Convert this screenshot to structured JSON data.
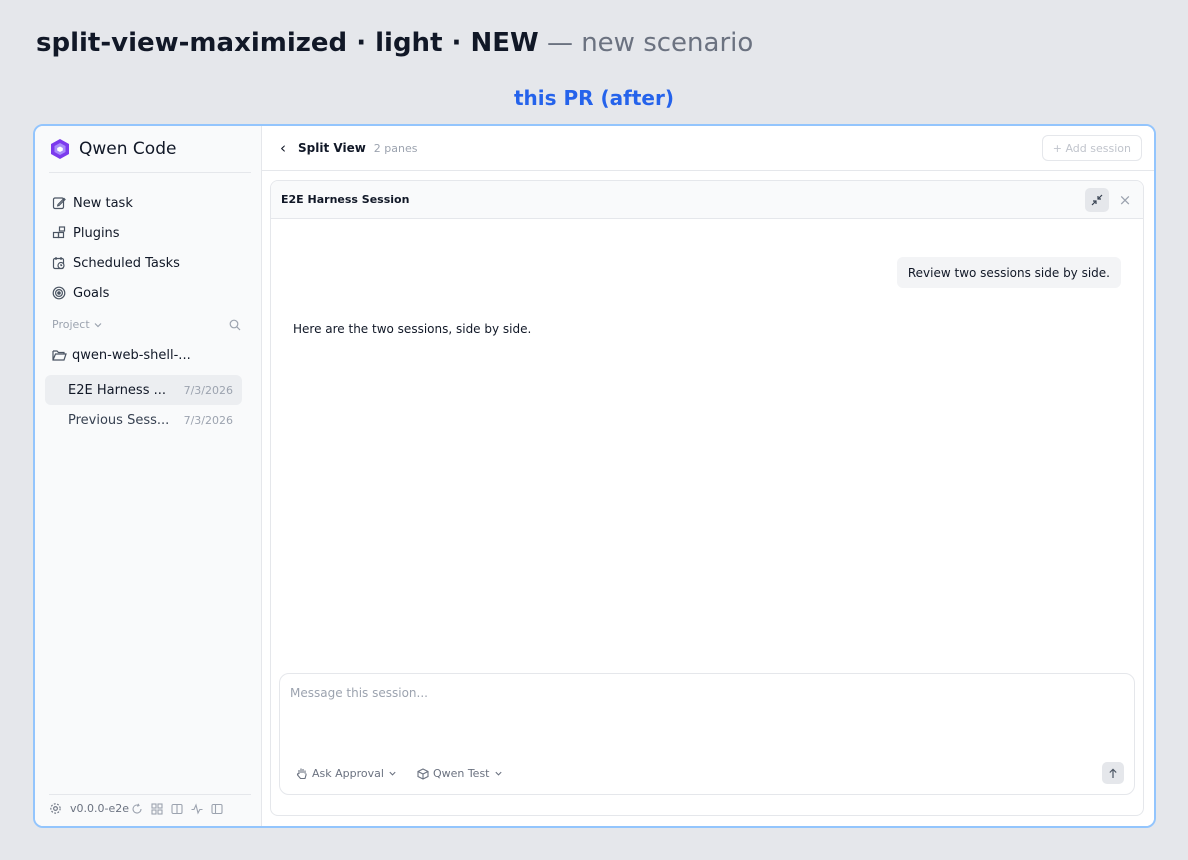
{
  "header": {
    "title_bold": "split-view-maximized · light · NEW",
    "title_suffix": "— new scenario",
    "caption": "this PR (after)"
  },
  "sidebar": {
    "brand": "Qwen Code",
    "nav": [
      {
        "label": "New task",
        "icon": "edit-icon"
      },
      {
        "label": "Plugins",
        "icon": "plugins-icon"
      },
      {
        "label": "Scheduled Tasks",
        "icon": "calendar-clock-icon"
      },
      {
        "label": "Goals",
        "icon": "target-icon"
      }
    ],
    "project_label": "Project",
    "folder": "qwen-web-shell-...",
    "sessions": [
      {
        "title": "E2E Harness ...",
        "date": "7/3/2026"
      },
      {
        "title": "Previous Sess...",
        "date": "7/3/2026"
      }
    ],
    "version": "v0.0.0-e2e"
  },
  "topbar": {
    "back_glyph": "‹",
    "title": "Split View",
    "pane_count": "2 panes",
    "add_session": "+ Add session"
  },
  "pane": {
    "title": "E2E Harness Session",
    "close_glyph": "×",
    "user_message": "Review two sessions side by side.",
    "assistant_message": "Here are the two sessions, side by side.",
    "composer": {
      "placeholder": "Message this session...",
      "approval": "Ask Approval",
      "model": "Qwen Test"
    }
  },
  "colors": {
    "accent": "#2563eb",
    "frame_border": "#93c5fd",
    "background": "#e5e7eb",
    "brand_purple": "#7c3aed"
  }
}
